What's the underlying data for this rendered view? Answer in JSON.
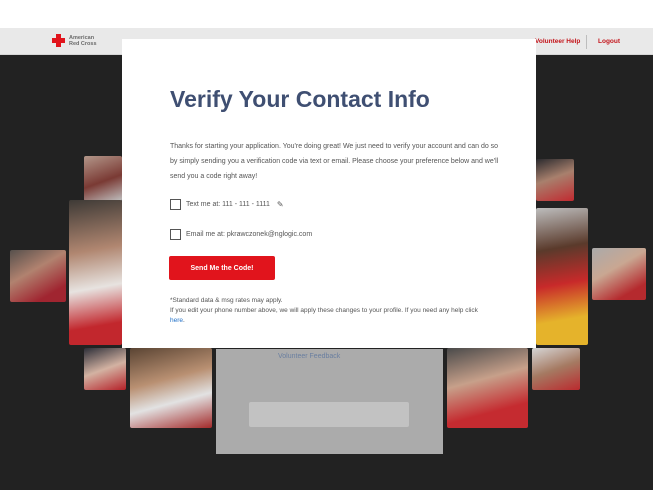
{
  "header": {
    "logo_text": "American\nRed Cross",
    "volunteer_help": "Volunteer Help",
    "logout": "Logout"
  },
  "background": {
    "panel_link": "Volunteer Feedback"
  },
  "modal": {
    "title": "Verify Your Contact Info",
    "intro": "Thanks for starting your application. You're doing great! We just need to verify your account and can do so by simply sending you a verification code via text or email. Please choose your preference below and we'll send you a code right away!",
    "text_option": "Text me at: 111 - 111 - 1111",
    "email_option": "Email me at: pkrawczonek@nglogic.com",
    "send_button": "Send Me the Code!",
    "footnote_1": "*Standard data & msg rates may apply.",
    "footnote_2": "If you edit your phone number above, we will apply these changes to your profile. If you need any help click",
    "help_link": "here",
    "period": "."
  },
  "colors": {
    "brand_red": "#e1141c",
    "title_navy": "#3f4f72",
    "link_blue": "#1f6fc7"
  },
  "icons": {
    "logo": "red-cross-icon",
    "edit": "pencil-icon"
  }
}
